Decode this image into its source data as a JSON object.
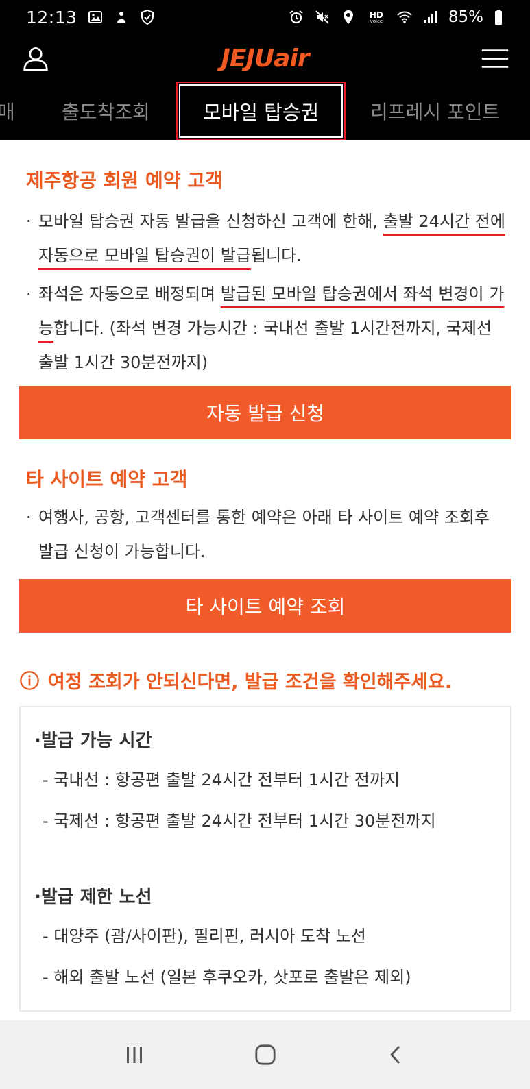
{
  "status_bar": {
    "time": "12:13",
    "battery_percent": "85%",
    "icons_left": [
      "gallery-icon",
      "notification-icon",
      "shield-check-icon"
    ],
    "icons_right": [
      "alarm-icon",
      "mute-icon",
      "location-icon",
      "hd-voice-icon",
      "wifi-icon",
      "signal-icon",
      "battery-icon"
    ],
    "hd_label": "HD",
    "hd_sub": "voice"
  },
  "header": {
    "logo_jeju": "JEJU",
    "logo_air": "air",
    "brand_color": "#f15a22",
    "user_icon": "user-icon",
    "menu_icon": "hamburger-menu-icon"
  },
  "tabs": {
    "partial_left": "매",
    "arrivals": "출도착조회",
    "active": "모바일 탑승권",
    "refresh": "리프레시 포인트"
  },
  "member_section": {
    "title": "제주항공 회원 예약 고객",
    "bullet1": {
      "part1": "모바일 탑승권 자동 발급을 신청하신 고객에 한해, ",
      "highlight": "출발 24시간 전에 자동으로 모바일 탑승권이 발급",
      "part2": "됩니다."
    },
    "bullet2": {
      "part1": "좌석은 자동으로 배정되며 ",
      "highlight": "발급된 모바일 탑승권에서 좌석 변경이 가능",
      "part2": "합니다. (좌석 변경 가능시간 : 국내선 출발 1시간전까지, 국제선 출발 1시간 30분전까지)"
    },
    "button_label": "자동 발급 신청"
  },
  "other_section": {
    "title": "타 사이트 예약 고객",
    "bullet": "여행사, 공항, 고객센터를 통한 예약은 아래 타 사이트 예약 조회후 발급 신청이 가능합니다.",
    "button_label": "타 사이트 예약 조회"
  },
  "notice": {
    "text": "여정 조회가 안되신다면, 발급 조건을 확인해주세요.",
    "icon": "info-icon"
  },
  "conditions": {
    "time_head": "발급 가능 시간",
    "domestic": "- 국내선 : 항공편 출발 24시간 전부터 1시간 전까지",
    "international": "- 국제선 : 항공편 출발 24시간 전부터 1시간 30분전까지",
    "restrict_head": "발급 제한 노선",
    "route1": "- 대양주 (괌/사이판), 필리핀, 러시아 도착 노선",
    "route2": "- 해외 출발 노선 (일본 후쿠오카, 삿포로 출발은 제외)"
  },
  "bullet_char": "·",
  "nav_bar": {
    "icons": [
      "recent-apps-icon",
      "home-icon",
      "back-icon"
    ]
  }
}
